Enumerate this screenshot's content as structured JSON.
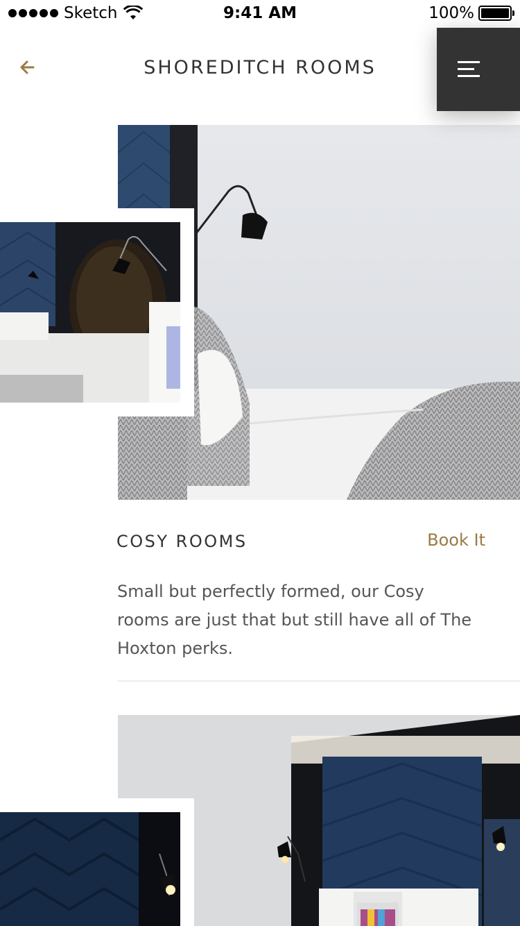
{
  "status_bar": {
    "carrier": "Sketch",
    "time": "9:41 AM",
    "battery": "100%"
  },
  "header": {
    "title": "SHOREDITCH ROOMS",
    "back_icon": "arrow-left-icon",
    "menu_icon": "hamburger-menu-icon"
  },
  "rooms": [
    {
      "title": "COSY ROOMS",
      "book_label": "Book It",
      "description": "Small but perfectly formed, our Cosy rooms are just that but still have all of The Hoxton perks."
    }
  ],
  "colors": {
    "accent": "#9c7a45",
    "menu_bg": "#333333",
    "text": "#333333",
    "body_text": "#555555",
    "divider": "#ececec"
  }
}
